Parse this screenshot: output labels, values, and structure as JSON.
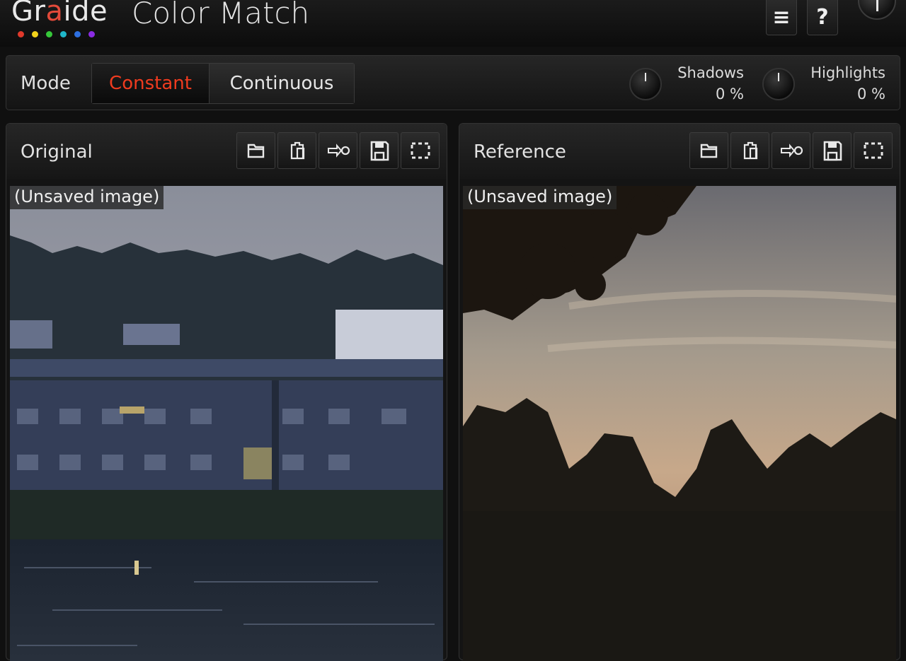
{
  "app": {
    "logo_text_pre": "Gr",
    "logo_text_accent": "a",
    "logo_text_post": "ide",
    "title": "Color Match",
    "logo_dot_colors": [
      "#e0392b",
      "#f2d21b",
      "#36c83a",
      "#1fb6c9",
      "#2d6fe0",
      "#8a2be2"
    ],
    "menu_icon": "≡",
    "help_icon": "?"
  },
  "mode": {
    "label": "Mode",
    "options": [
      "Constant",
      "Continuous"
    ],
    "selected": "Constant",
    "selected_color": "#ef3b1f"
  },
  "controls": {
    "shadows": {
      "label": "Shadows",
      "value": "0 %"
    },
    "highlights": {
      "label": "Highlights",
      "value": "0 %"
    }
  },
  "panels": {
    "original": {
      "title": "Original",
      "caption": "(Unsaved image)"
    },
    "reference": {
      "title": "Reference",
      "caption": "(Unsaved image)"
    },
    "toolbar_icons": [
      "open-folder-icon",
      "paste-icon",
      "apply-arrow-icon",
      "save-icon",
      "select-region-icon"
    ]
  }
}
